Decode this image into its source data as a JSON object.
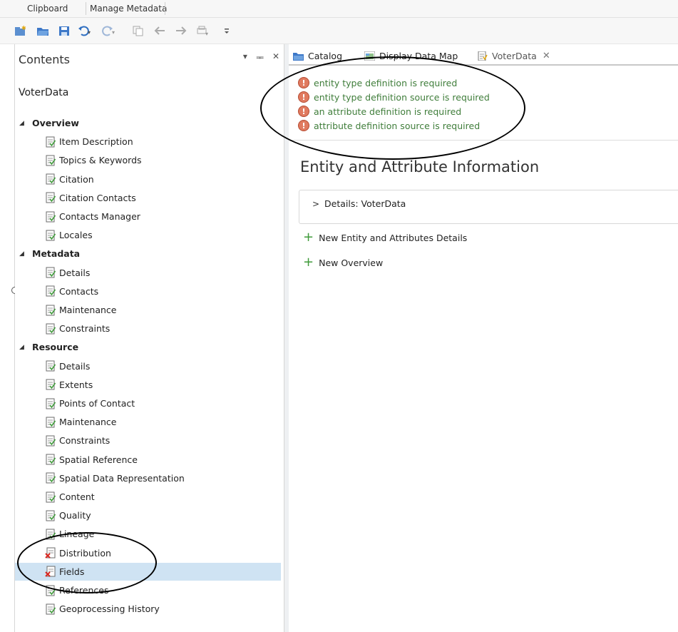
{
  "ribbon": {
    "groups": [
      "Clipboard",
      "Manage Metadata"
    ]
  },
  "qat": {
    "icons": [
      "new-icon",
      "open-icon",
      "save-icon",
      "undo-icon",
      "redo-icon",
      "copy-icon",
      "back-icon",
      "forward-icon",
      "print-icon",
      "customize-icon"
    ]
  },
  "contents": {
    "title": "Contents",
    "controls": [
      "▾",
      "ᴾ",
      "✕"
    ],
    "doc_name": "VoterData",
    "overview": {
      "label": "Overview",
      "items": [
        "Item Description",
        "Topics & Keywords",
        "Citation",
        "Citation Contacts",
        "Contacts Manager",
        "Locales"
      ]
    },
    "metadata": {
      "label": "Metadata",
      "items": [
        "Details",
        "Contacts",
        "Maintenance",
        "Constraints"
      ]
    },
    "resource": {
      "label": "Resource",
      "items": [
        "Details",
        "Extents",
        "Points of Contact",
        "Maintenance",
        "Constraints",
        "Spatial Reference",
        "Spatial Data Representation",
        "Content",
        "Quality",
        "Lineage",
        "Distribution",
        "Fields",
        "References",
        "Geoprocessing History"
      ]
    }
  },
  "tabs": [
    {
      "label": "Catalog"
    },
    {
      "label": "Display Data Map"
    },
    {
      "label": "VoterData",
      "close": "✕"
    }
  ],
  "issues": [
    "entity type definition is required",
    "entity type definition source is required",
    "an attribute definition is required",
    "attribute definition source is required"
  ],
  "main": {
    "section_title": "Entity and Attribute Information",
    "details_label": "Details:  VoterData",
    "new_entity_label": "New Entity and Attributes Details",
    "new_overview_label": "New Overview"
  },
  "colors": {
    "issue_text": "#3f7d3a",
    "warning": "#e07a5f",
    "selected_row": "#cfe3f3",
    "plus": "#3f9a3a"
  }
}
